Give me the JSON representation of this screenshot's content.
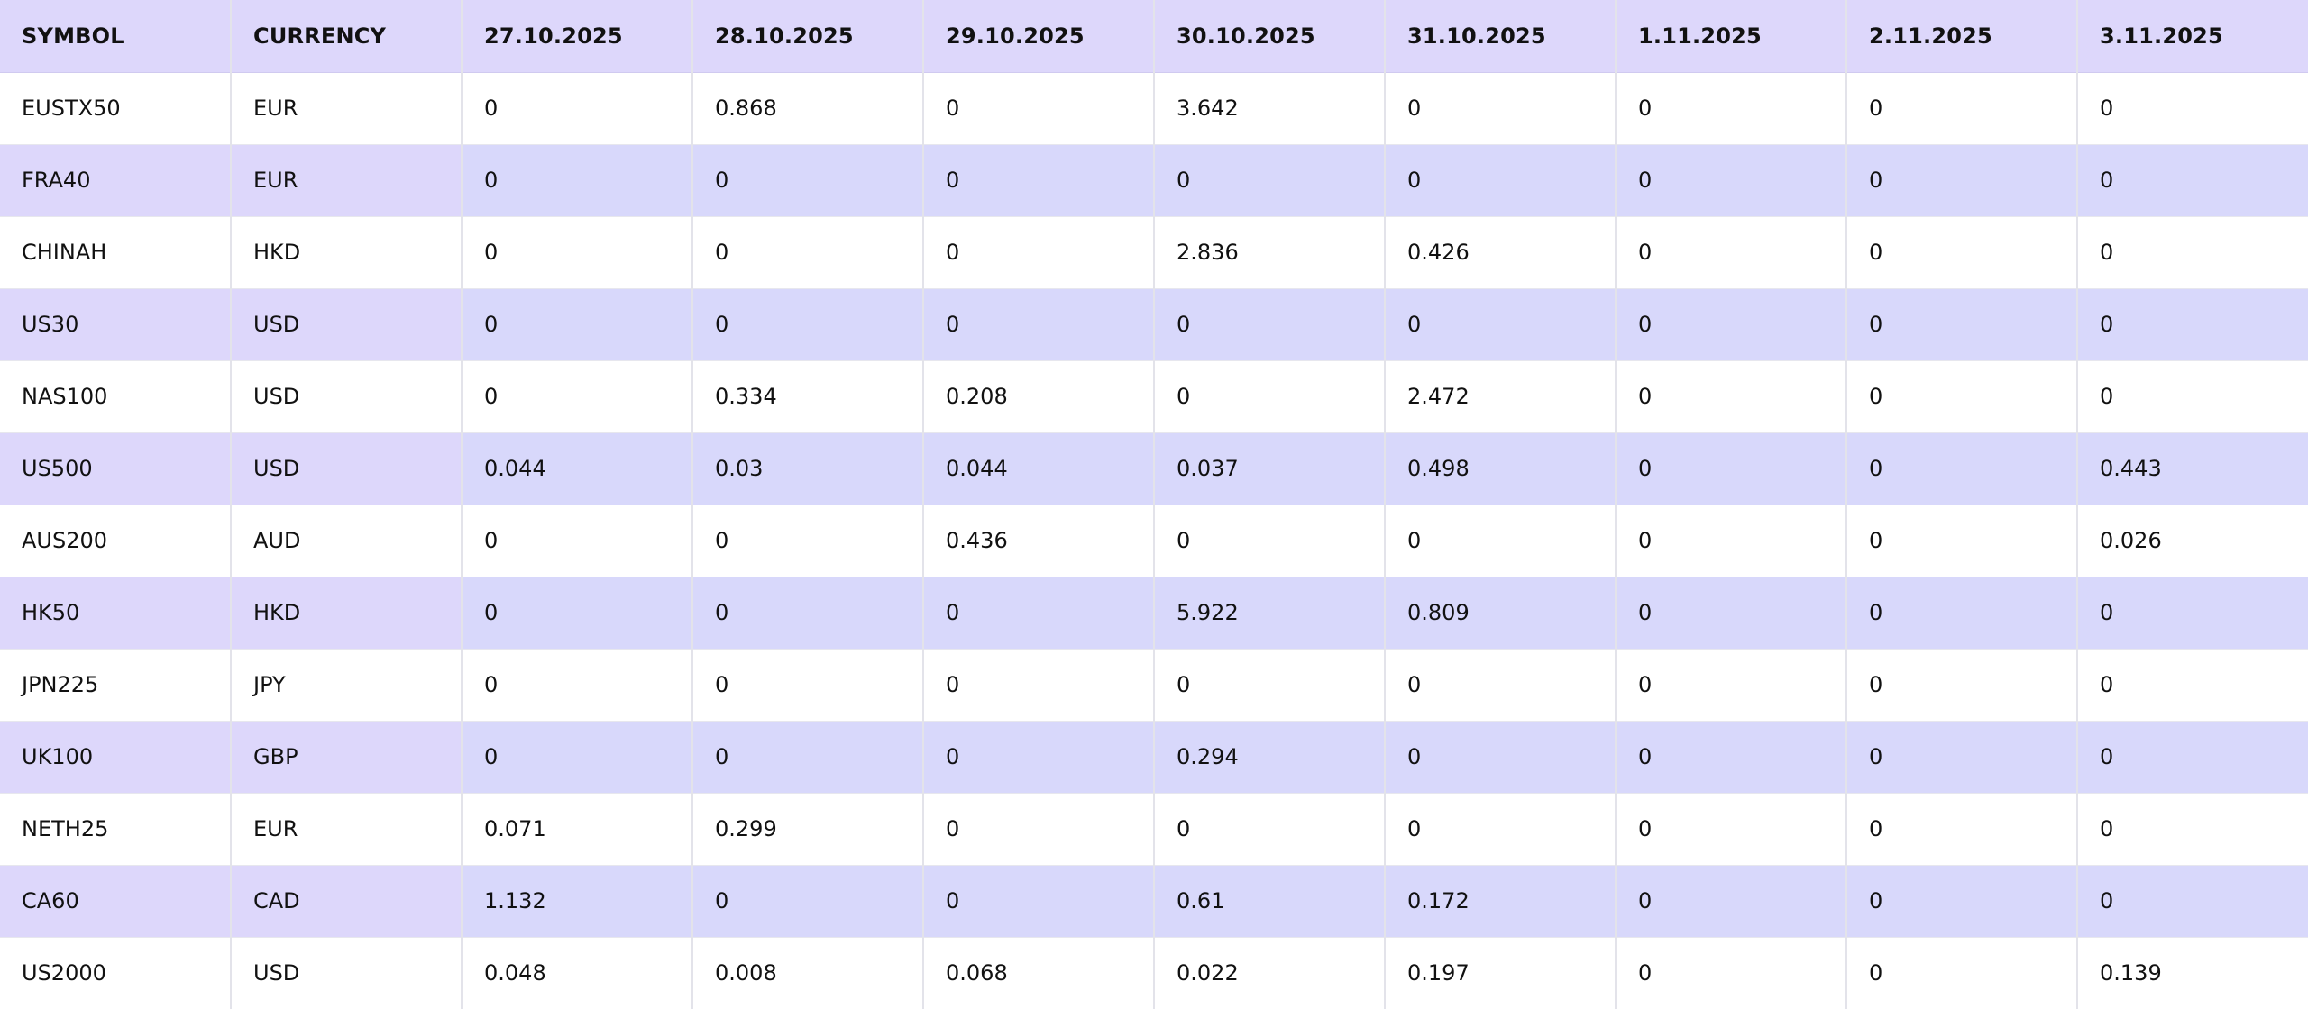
{
  "table": {
    "columns": [
      "SYMBOL",
      "CURRENCY",
      "27.10.2025",
      "28.10.2025",
      "29.10.2025",
      "30.10.2025",
      "31.10.2025",
      "1.11.2025",
      "2.11.2025",
      "3.11.2025"
    ],
    "rows": [
      [
        "EUSTX50",
        "EUR",
        "0",
        "0.868",
        "0",
        "3.642",
        "0",
        "0",
        "0",
        "0"
      ],
      [
        "FRA40",
        "EUR",
        "0",
        "0",
        "0",
        "0",
        "0",
        "0",
        "0",
        "0"
      ],
      [
        "CHINAH",
        "HKD",
        "0",
        "0",
        "0",
        "2.836",
        "0.426",
        "0",
        "0",
        "0"
      ],
      [
        "US30",
        "USD",
        "0",
        "0",
        "0",
        "0",
        "0",
        "0",
        "0",
        "0"
      ],
      [
        "NAS100",
        "USD",
        "0",
        "0.334",
        "0.208",
        "0",
        "2.472",
        "0",
        "0",
        "0"
      ],
      [
        "US500",
        "USD",
        "0.044",
        "0.03",
        "0.044",
        "0.037",
        "0.498",
        "0",
        "0",
        "0.443"
      ],
      [
        "AUS200",
        "AUD",
        "0",
        "0",
        "0.436",
        "0",
        "0",
        "0",
        "0",
        "0.026"
      ],
      [
        "HK50",
        "HKD",
        "0",
        "0",
        "0",
        "5.922",
        "0.809",
        "0",
        "0",
        "0"
      ],
      [
        "JPN225",
        "JPY",
        "0",
        "0",
        "0",
        "0",
        "0",
        "0",
        "0",
        "0"
      ],
      [
        "UK100",
        "GBP",
        "0",
        "0",
        "0",
        "0.294",
        "0",
        "0",
        "0",
        "0"
      ],
      [
        "NETH25",
        "EUR",
        "0.071",
        "0.299",
        "0",
        "0",
        "0",
        "0",
        "0",
        "0"
      ],
      [
        "CA60",
        "CAD",
        "1.132",
        "0",
        "0",
        "0.61",
        "0.172",
        "0",
        "0",
        "0"
      ],
      [
        "US2000",
        "USD",
        "0.048",
        "0.008",
        "0.068",
        "0.022",
        "0.197",
        "0",
        "0",
        "0.139"
      ]
    ]
  },
  "colors": {
    "header_bg": "#ddd7fb",
    "stripe_bg": "#d8d8fb",
    "text": "#111111"
  }
}
